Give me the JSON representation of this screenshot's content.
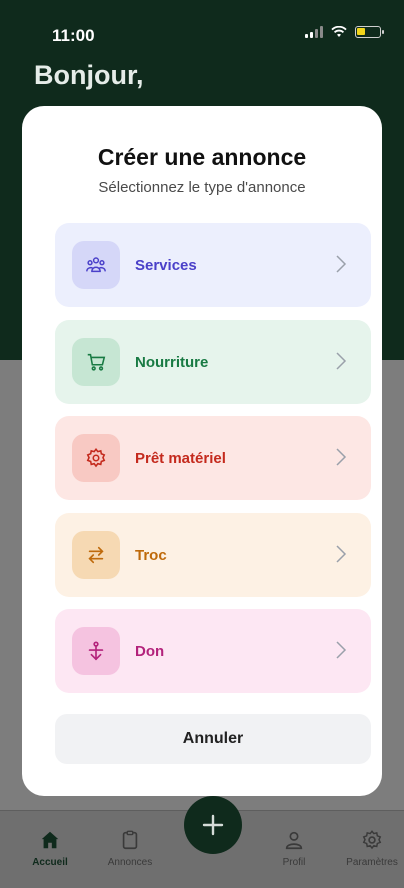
{
  "status": {
    "time": "11:00"
  },
  "home": {
    "greeting": "Bonjour,"
  },
  "modal": {
    "title": "Créer une annonce",
    "subtitle": "Sélectionnez le type d'annonce",
    "options": [
      {
        "label": "Services",
        "icon": "users-icon",
        "bg": "#eceffd",
        "iconBg": "#d5d7f8",
        "color": "#4a40c9"
      },
      {
        "label": "Nourriture",
        "icon": "cart-icon",
        "bg": "#e6f4ec",
        "iconBg": "#c6e6d3",
        "color": "#187a43"
      },
      {
        "label": "Prêt matériel",
        "icon": "gear-icon",
        "bg": "#fde7e4",
        "iconBg": "#f8c9c3",
        "color": "#c42a1d"
      },
      {
        "label": "Troc",
        "icon": "swap-icon",
        "bg": "#fdf1e4",
        "iconBg": "#f6d9b3",
        "color": "#bf6a0b"
      },
      {
        "label": "Don",
        "icon": "anchor-icon",
        "bg": "#fde7f3",
        "iconBg": "#f5c3e0",
        "color": "#b3227b"
      }
    ],
    "cancel_label": "Annuler"
  },
  "nav": {
    "items": [
      {
        "label": "Accueil",
        "icon": "home-icon"
      },
      {
        "label": "Annonces",
        "icon": "clipboard-icon"
      },
      {
        "label": "Profil",
        "icon": "user-icon"
      },
      {
        "label": "Paramètres",
        "icon": "settings-icon"
      }
    ],
    "fab_icon": "plus-icon"
  }
}
